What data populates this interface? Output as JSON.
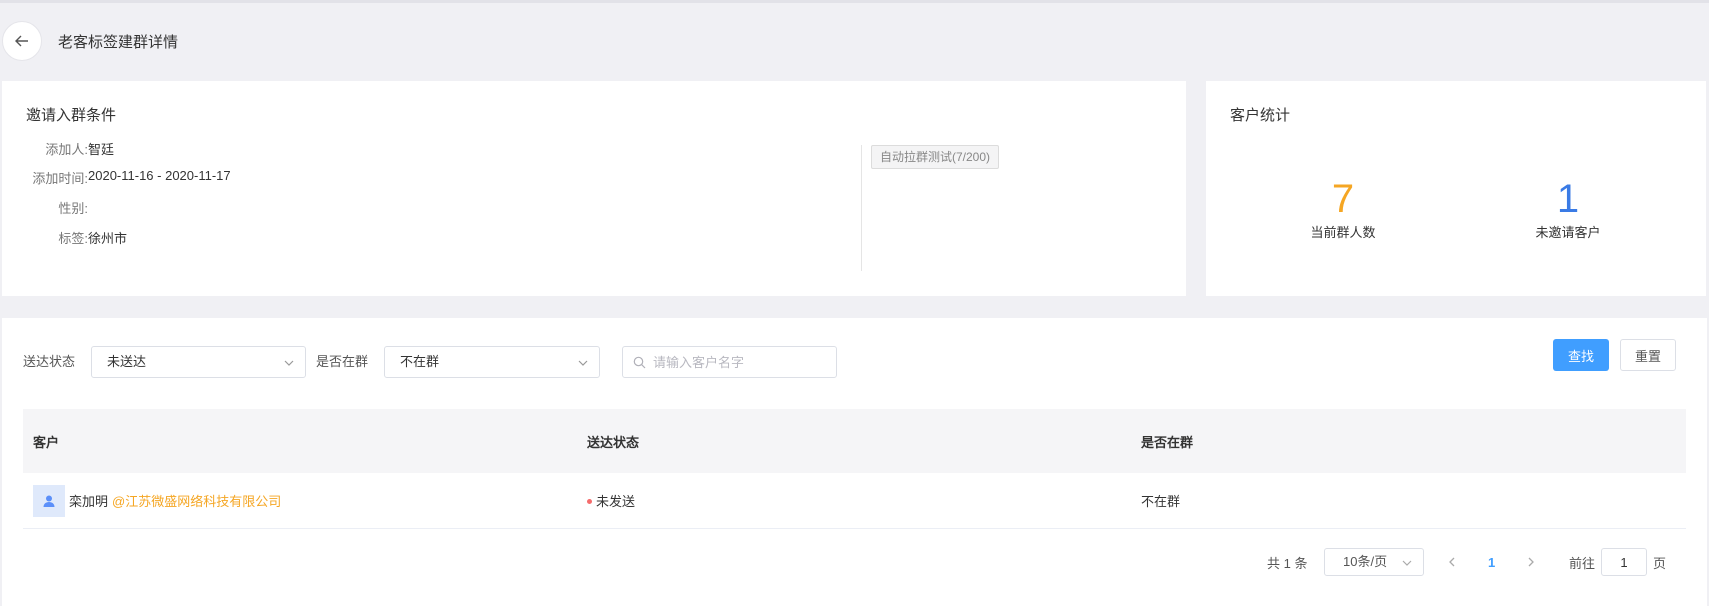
{
  "header": {
    "title": "老客标签建群详情"
  },
  "conditions": {
    "title": "邀请入群条件",
    "rows": [
      {
        "label": "添加人:",
        "value": "智廷"
      },
      {
        "label": "添加时间:",
        "value": "2020-11-16 - 2020-11-17"
      },
      {
        "label": "性别:",
        "value": ""
      },
      {
        "label": "标签:",
        "value": "徐州市"
      }
    ],
    "group_tag": "自动拉群测试(7/200)"
  },
  "stats": {
    "title": "客户统计",
    "items": [
      {
        "value": "7",
        "label": "当前群人数",
        "color": "#f5a623"
      },
      {
        "value": "1",
        "label": "未邀请客户",
        "color": "#3a7be5"
      }
    ]
  },
  "filters": {
    "send_status_label": "送达状态",
    "send_status_value": "未送达",
    "in_group_label": "是否在群",
    "in_group_value": "不在群",
    "search_placeholder": "请输入客户名字",
    "search_button": "查找",
    "reset_button": "重置"
  },
  "table": {
    "headers": [
      "客户",
      "送达状态",
      "是否在群"
    ],
    "rows": [
      {
        "name": "栾加明",
        "corp": "@江苏微盛网络科技有限公司",
        "status": "未发送",
        "in_group": "不在群"
      }
    ]
  },
  "pagination": {
    "total": "共 1 条",
    "page_size": "10条/页",
    "current_page": "1",
    "goto_label": "前往",
    "goto_value": "1",
    "goto_suffix": "页"
  },
  "colors": {
    "primary": "#409eff",
    "accent_orange": "#f5a623",
    "accent_blue": "#3a7be5",
    "error_dot": "#f56c6c"
  }
}
